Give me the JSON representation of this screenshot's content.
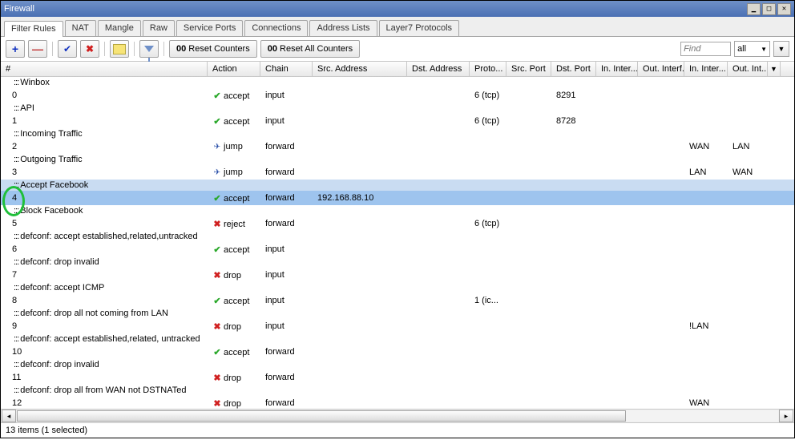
{
  "window": {
    "title": "Firewall"
  },
  "tabs": [
    "Filter Rules",
    "NAT",
    "Mangle",
    "Raw",
    "Service Ports",
    "Connections",
    "Address Lists",
    "Layer7 Protocols"
  ],
  "active_tab": 0,
  "toolbar": {
    "reset_counters": "Reset Counters",
    "reset_all_counters": "Reset All Counters",
    "find_placeholder": "Find",
    "filter_select": "all"
  },
  "columns": [
    "#",
    "Action",
    "Chain",
    "Src. Address",
    "Dst. Address",
    "Proto...",
    "Src. Port",
    "Dst. Port",
    "In. Inter...",
    "Out. Interf...",
    "In. Inter...",
    "Out. Int..."
  ],
  "status": "13 items (1 selected)",
  "rows": [
    {
      "type": "comment",
      "text": "Winbox"
    },
    {
      "type": "rule",
      "num": "0",
      "action": "accept",
      "chain": "input",
      "src": "",
      "dst": "",
      "proto": "6 (tcp)",
      "sp": "",
      "dp": "8291",
      "ii": "",
      "oi": "",
      "il": "",
      "ol": ""
    },
    {
      "type": "comment",
      "text": "API"
    },
    {
      "type": "rule",
      "num": "1",
      "action": "accept",
      "chain": "input",
      "src": "",
      "dst": "",
      "proto": "6 (tcp)",
      "sp": "",
      "dp": "8728",
      "ii": "",
      "oi": "",
      "il": "",
      "ol": ""
    },
    {
      "type": "comment",
      "text": "Incoming Traffic"
    },
    {
      "type": "rule",
      "num": "2",
      "action": "jump",
      "chain": "forward",
      "src": "",
      "dst": "",
      "proto": "",
      "sp": "",
      "dp": "",
      "ii": "",
      "oi": "",
      "il": "WAN",
      "ol": "LAN"
    },
    {
      "type": "comment",
      "text": "Outgoing Traffic"
    },
    {
      "type": "rule",
      "num": "3",
      "action": "jump",
      "chain": "forward",
      "src": "",
      "dst": "",
      "proto": "",
      "sp": "",
      "dp": "",
      "ii": "",
      "oi": "",
      "il": "LAN",
      "ol": "WAN"
    },
    {
      "type": "comment",
      "text": "Accept Facebook",
      "selected": "soft"
    },
    {
      "type": "rule",
      "num": "4",
      "action": "accept",
      "chain": "forward",
      "src": "192.168.88.10",
      "dst": "",
      "proto": "",
      "sp": "",
      "dp": "",
      "ii": "",
      "oi": "",
      "il": "",
      "ol": "",
      "selected": "hard"
    },
    {
      "type": "comment",
      "text": "Block Facebook"
    },
    {
      "type": "rule",
      "num": "5",
      "action": "reject",
      "chain": "forward",
      "src": "",
      "dst": "",
      "proto": "6 (tcp)",
      "sp": "",
      "dp": "",
      "ii": "",
      "oi": "",
      "il": "",
      "ol": ""
    },
    {
      "type": "comment",
      "text": "defconf: accept established,related,untracked"
    },
    {
      "type": "rule",
      "num": "6",
      "action": "accept",
      "chain": "input",
      "src": "",
      "dst": "",
      "proto": "",
      "sp": "",
      "dp": "",
      "ii": "",
      "oi": "",
      "il": "",
      "ol": ""
    },
    {
      "type": "comment",
      "text": "defconf: drop invalid"
    },
    {
      "type": "rule",
      "num": "7",
      "action": "drop",
      "chain": "input",
      "src": "",
      "dst": "",
      "proto": "",
      "sp": "",
      "dp": "",
      "ii": "",
      "oi": "",
      "il": "",
      "ol": ""
    },
    {
      "type": "comment",
      "text": "defconf: accept ICMP"
    },
    {
      "type": "rule",
      "num": "8",
      "action": "accept",
      "chain": "input",
      "src": "",
      "dst": "",
      "proto": "1 (ic...",
      "sp": "",
      "dp": "",
      "ii": "",
      "oi": "",
      "il": "",
      "ol": ""
    },
    {
      "type": "comment",
      "text": "defconf: drop all not coming from LAN"
    },
    {
      "type": "rule",
      "num": "9",
      "action": "drop",
      "chain": "input",
      "src": "",
      "dst": "",
      "proto": "",
      "sp": "",
      "dp": "",
      "ii": "",
      "oi": "",
      "il": "!LAN",
      "ol": ""
    },
    {
      "type": "comment",
      "text": "defconf: accept established,related, untracked"
    },
    {
      "type": "rule",
      "num": "10",
      "action": "accept",
      "chain": "forward",
      "src": "",
      "dst": "",
      "proto": "",
      "sp": "",
      "dp": "",
      "ii": "",
      "oi": "",
      "il": "",
      "ol": ""
    },
    {
      "type": "comment",
      "text": "defconf: drop invalid"
    },
    {
      "type": "rule",
      "num": "11",
      "action": "drop",
      "chain": "forward",
      "src": "",
      "dst": "",
      "proto": "",
      "sp": "",
      "dp": "",
      "ii": "",
      "oi": "",
      "il": "",
      "ol": ""
    },
    {
      "type": "comment",
      "text": "defconf: drop all from WAN not DSTNATed"
    },
    {
      "type": "rule",
      "num": "12",
      "action": "drop",
      "chain": "forward",
      "src": "",
      "dst": "",
      "proto": "",
      "sp": "",
      "dp": "",
      "ii": "",
      "oi": "",
      "il": "WAN",
      "ol": ""
    }
  ],
  "action_icons": {
    "accept": "✔",
    "jump": "✈",
    "reject": "✖",
    "drop": "✖"
  },
  "annotation": {
    "row_index_top": 9,
    "row_index_bottom": 11
  }
}
